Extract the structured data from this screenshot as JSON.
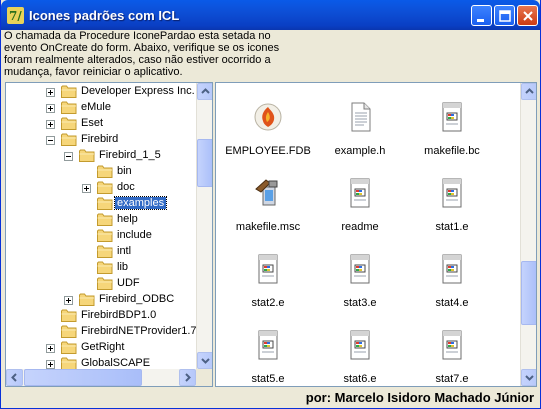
{
  "window": {
    "title": "Icones padrões com ICL"
  },
  "info": {
    "lines": [
      "O chamada da Procedure IconePardao esta setada no",
      "evento OnCreate do form. Abaixo, verifique se os icones",
      "foram realmente alterados, caso não estiver ocorrido a",
      "mudança, favor reiniciar o aplicativo."
    ]
  },
  "tree": {
    "items": [
      {
        "label": "Developer Express Inc.",
        "level": 0,
        "expander": "plus"
      },
      {
        "label": "eMule",
        "level": 0,
        "expander": "plus"
      },
      {
        "label": "Eset",
        "level": 0,
        "expander": "plus"
      },
      {
        "label": "Firebird",
        "level": 0,
        "expander": "minus"
      },
      {
        "label": "Firebird_1_5",
        "level": 1,
        "expander": "minus"
      },
      {
        "label": "bin",
        "level": 2,
        "expander": "none"
      },
      {
        "label": "doc",
        "level": 2,
        "expander": "plus"
      },
      {
        "label": "examples",
        "level": 2,
        "expander": "none",
        "selected": true
      },
      {
        "label": "help",
        "level": 2,
        "expander": "none"
      },
      {
        "label": "include",
        "level": 2,
        "expander": "none"
      },
      {
        "label": "intl",
        "level": 2,
        "expander": "none"
      },
      {
        "label": "lib",
        "level": 2,
        "expander": "none"
      },
      {
        "label": "UDF",
        "level": 2,
        "expander": "none"
      },
      {
        "label": "Firebird_ODBC",
        "level": 1,
        "expander": "plus"
      },
      {
        "label": "FirebirdBDP1.0",
        "level": 0,
        "expander": "none"
      },
      {
        "label": "FirebirdNETProvider1.7",
        "level": 0,
        "expander": "none"
      },
      {
        "label": "GetRight",
        "level": 0,
        "expander": "plus"
      },
      {
        "label": "GlobalSCAPE",
        "level": 0,
        "expander": "plus"
      }
    ]
  },
  "files": [
    {
      "name": "EMPLOYEE.FDB",
      "icon": "firebird-db-icon"
    },
    {
      "name": "example.h",
      "icon": "text-file-icon"
    },
    {
      "name": "makefile.bc",
      "icon": "document-file-icon"
    },
    {
      "name": "makefile.msc",
      "icon": "build-tool-icon"
    },
    {
      "name": "readme",
      "icon": "document-file-icon"
    },
    {
      "name": "stat1.e",
      "icon": "document-file-icon"
    },
    {
      "name": "stat2.e",
      "icon": "document-file-icon"
    },
    {
      "name": "stat3.e",
      "icon": "document-file-icon"
    },
    {
      "name": "stat4.e",
      "icon": "document-file-icon"
    },
    {
      "name": "stat5.e",
      "icon": "document-file-icon"
    },
    {
      "name": "stat6.e",
      "icon": "document-file-icon"
    },
    {
      "name": "stat7.e",
      "icon": "document-file-icon"
    }
  ],
  "status": {
    "text": "por: Marcelo Isidoro Machado Júnior"
  },
  "colors": {
    "titlebar": "#0a4fd6",
    "selection": "#316ac5",
    "window_bg": "#ece9d8"
  }
}
